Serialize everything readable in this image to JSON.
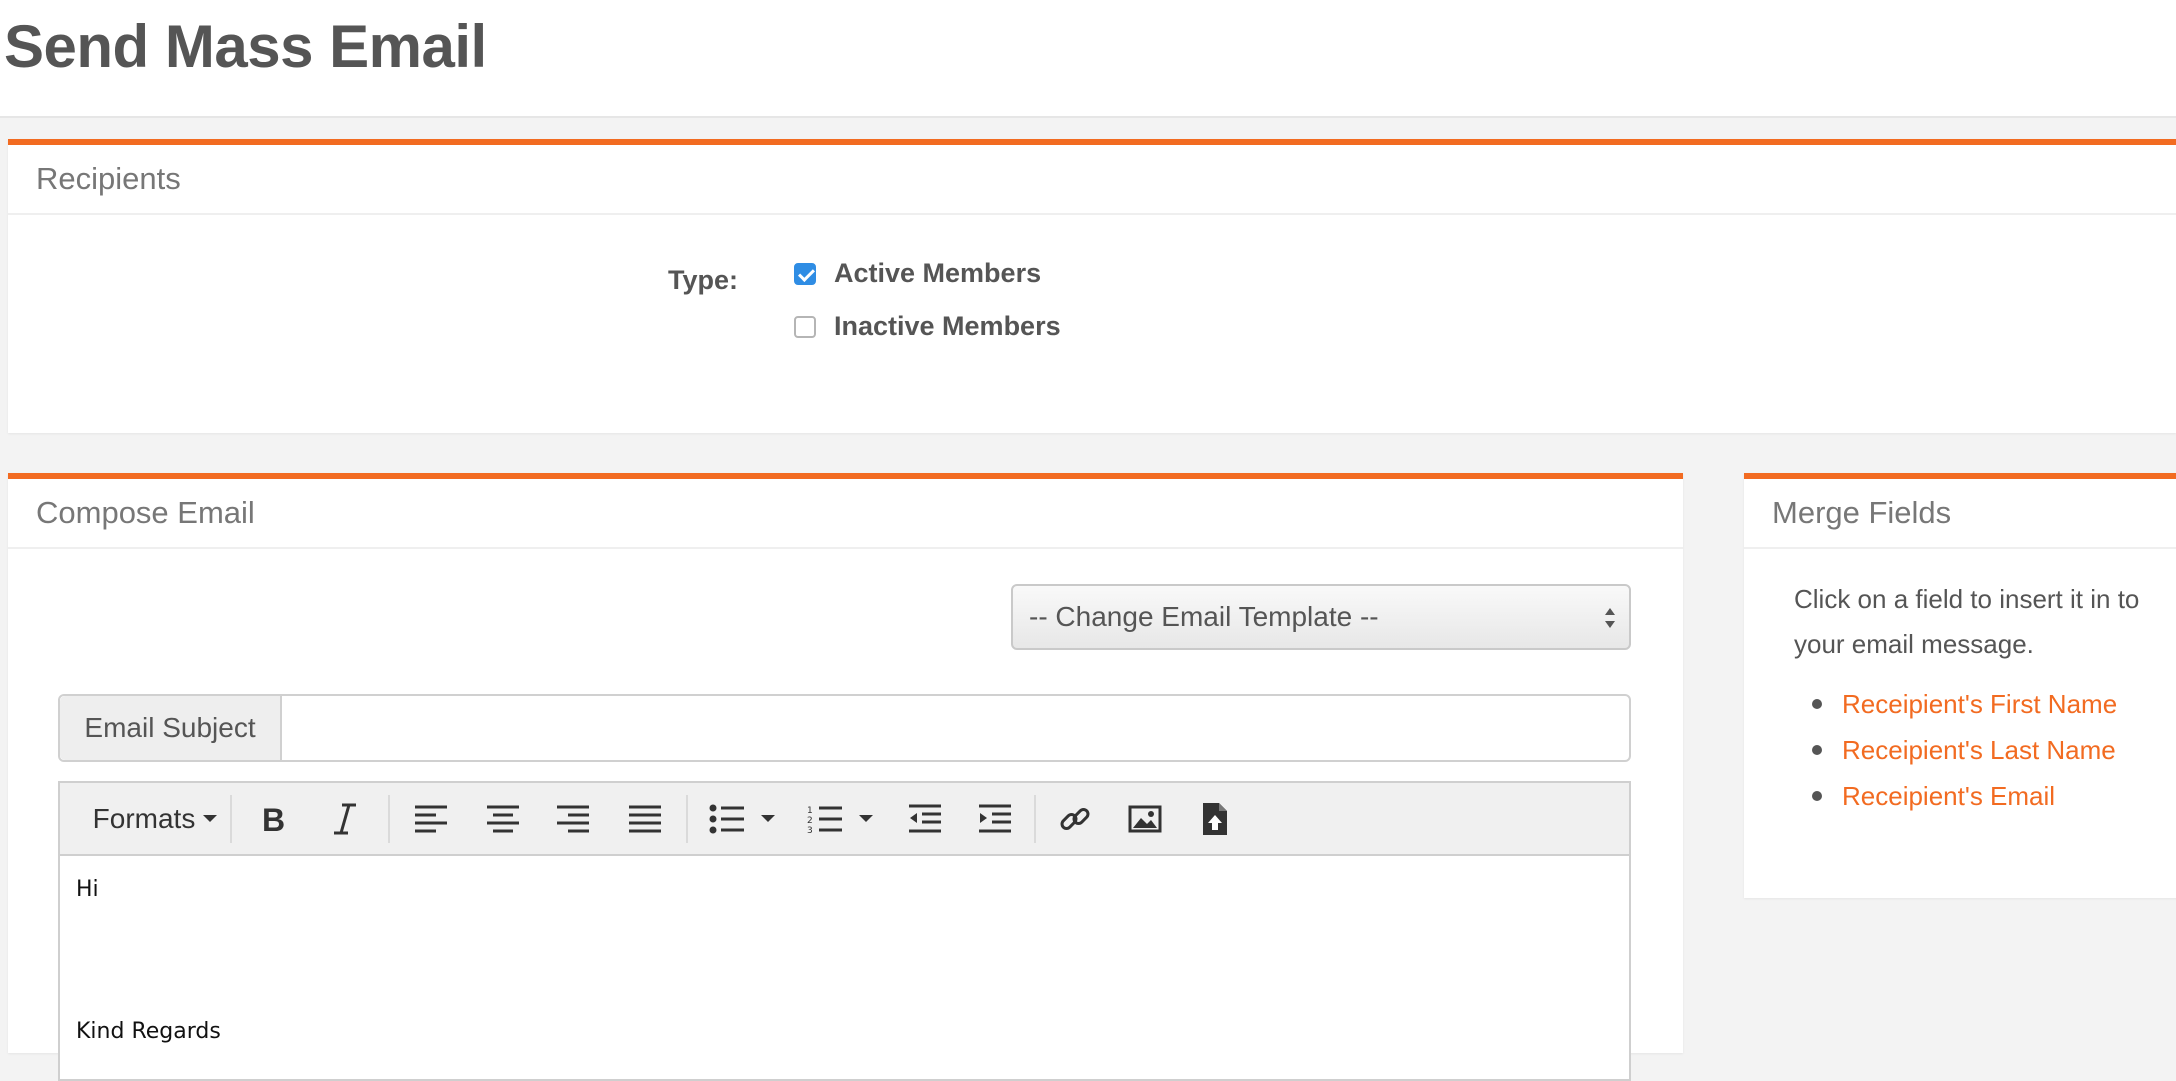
{
  "page": {
    "title": "Send Mass Email"
  },
  "recipients": {
    "heading": "Recipients",
    "type_label": "Type:",
    "options": [
      {
        "label": "Active Members",
        "checked": true
      },
      {
        "label": "Inactive Members",
        "checked": false
      }
    ]
  },
  "compose": {
    "heading": "Compose Email",
    "template_select": {
      "selected": "-- Change Email Template --"
    },
    "subject": {
      "label": "Email Subject",
      "value": ""
    },
    "toolbar": {
      "formats_label": "Formats",
      "icons": [
        "bold-icon",
        "italic-icon",
        "align-left-icon",
        "align-center-icon",
        "align-right-icon",
        "align-justify-icon",
        "bullet-list-icon",
        "numbered-list-icon",
        "outdent-icon",
        "indent-icon",
        "link-icon",
        "image-icon",
        "file-upload-icon"
      ]
    },
    "body": {
      "line1": "Hi",
      "line2": "Kind Regards"
    }
  },
  "merge": {
    "heading": "Merge Fields",
    "instructions": "Click on a field to insert it in to your email message.",
    "fields": [
      "Receipient's First Name",
      "Receipient's Last Name",
      "Receipient's Email"
    ]
  },
  "colors": {
    "accent": "#f26b21",
    "checkbox": "#2f8de4"
  }
}
